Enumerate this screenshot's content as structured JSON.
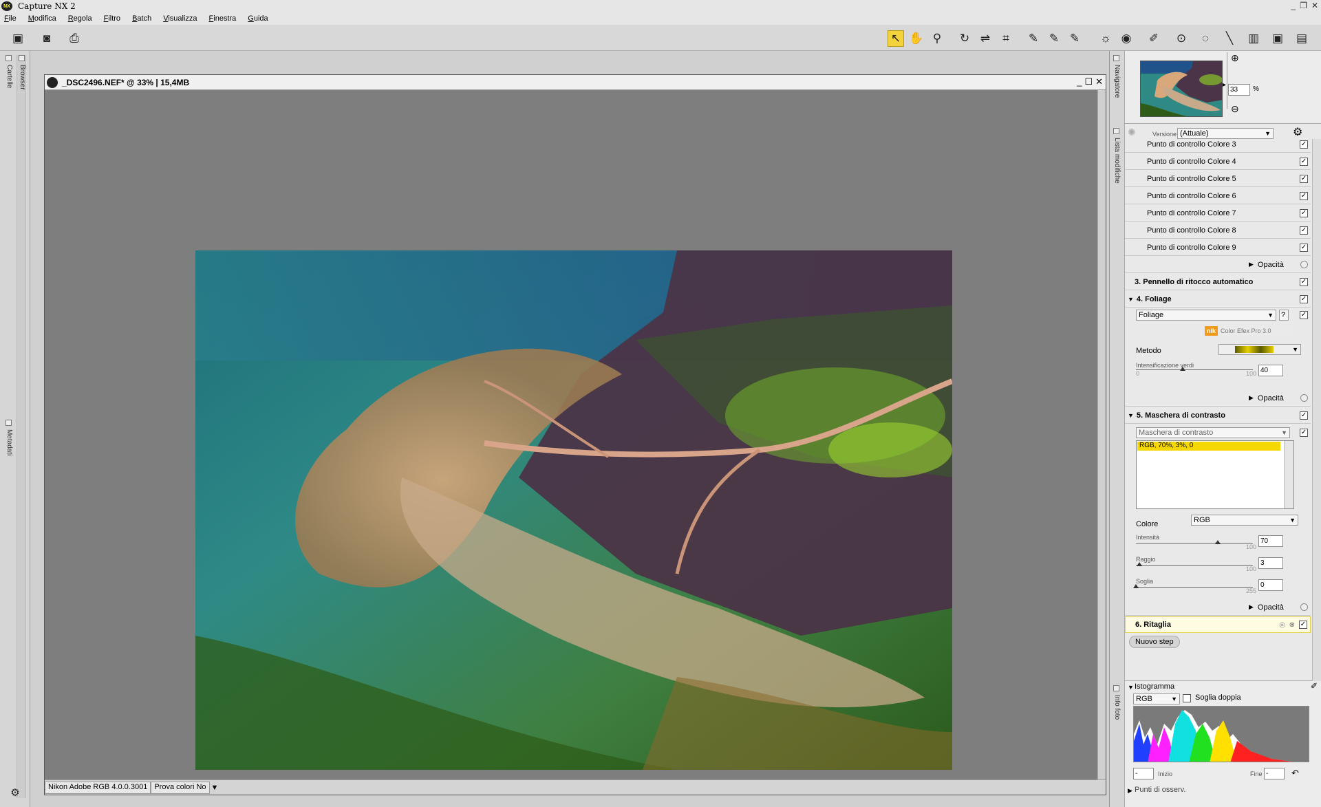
{
  "app": {
    "title": "Capture NX 2",
    "window_controls": [
      "_",
      "❐",
      "✕"
    ]
  },
  "menu": [
    "File",
    "Modifica",
    "Regola",
    "Filtro",
    "Batch",
    "Visualizza",
    "Finestra",
    "Guida"
  ],
  "left_dock": {
    "tabs": [
      "Cartelle",
      "Browser",
      "Metadati"
    ]
  },
  "document": {
    "title": "_DSC2496.NEF* @ 33% | 15,4MB",
    "status_profile": "Nikon Adobe RGB 4.0.0.3001",
    "status_proof": "Prova colori No"
  },
  "right_panel": {
    "tabs": {
      "navigator": "Navigatore",
      "edit_list": "Lista modifiche",
      "photo_info": "Info foto"
    },
    "navigator": {
      "zoom_value": "33",
      "zoom_unit": "%"
    },
    "edit_list": {
      "version_label": "Versione",
      "version_value": "(Attuale)",
      "control_points": [
        "Punto di controllo Colore 3",
        "Punto di controllo Colore 4",
        "Punto di controllo Colore 5",
        "Punto di controllo Colore 6",
        "Punto di controllo Colore 7",
        "Punto di controllo Colore 8",
        "Punto di controllo Colore 9"
      ],
      "opacity_label": "Opacità",
      "step3": "3. Pennello di ritocco automatico",
      "step4": "4. Foliage",
      "step4_filter": "Foliage",
      "step4_help": "?",
      "nik_brand": "Color Efex Pro 3.0",
      "method_label": "Metodo",
      "green_label": "Intensificazione verdi",
      "green_value": "40",
      "green_min": "0",
      "green_max": "100",
      "step5": "5. Maschera di contrasto",
      "step5_filter": "Maschera di contrasto",
      "step5_list_item": "RGB, 70%, 3%, 0",
      "color_label": "Colore",
      "color_value": "RGB",
      "intensity_label": "Intensità",
      "intensity_value": "70",
      "radius_label": "Raggio",
      "radius_value": "3",
      "threshold_label": "Soglia",
      "threshold_value": "0",
      "range_max": "100",
      "threshold_max": "255",
      "step6": "6. Ritaglia",
      "new_step": "Nuovo step"
    },
    "histogram": {
      "title": "Istogramma",
      "channel": "RGB",
      "double_threshold": "Soglia doppia",
      "start_label": "Inizio",
      "end_label": "Fine",
      "start_value": "-",
      "end_value": "-"
    },
    "points_label": "Punti di osserv."
  },
  "sliders": {
    "green_fraction": 0.4,
    "intensity_fraction": 0.7,
    "radius_fraction": 0.03,
    "threshold_fraction": 0.0
  },
  "colors": {
    "active_tool": "#f4d23c",
    "selected_item": "#f5d800"
  }
}
